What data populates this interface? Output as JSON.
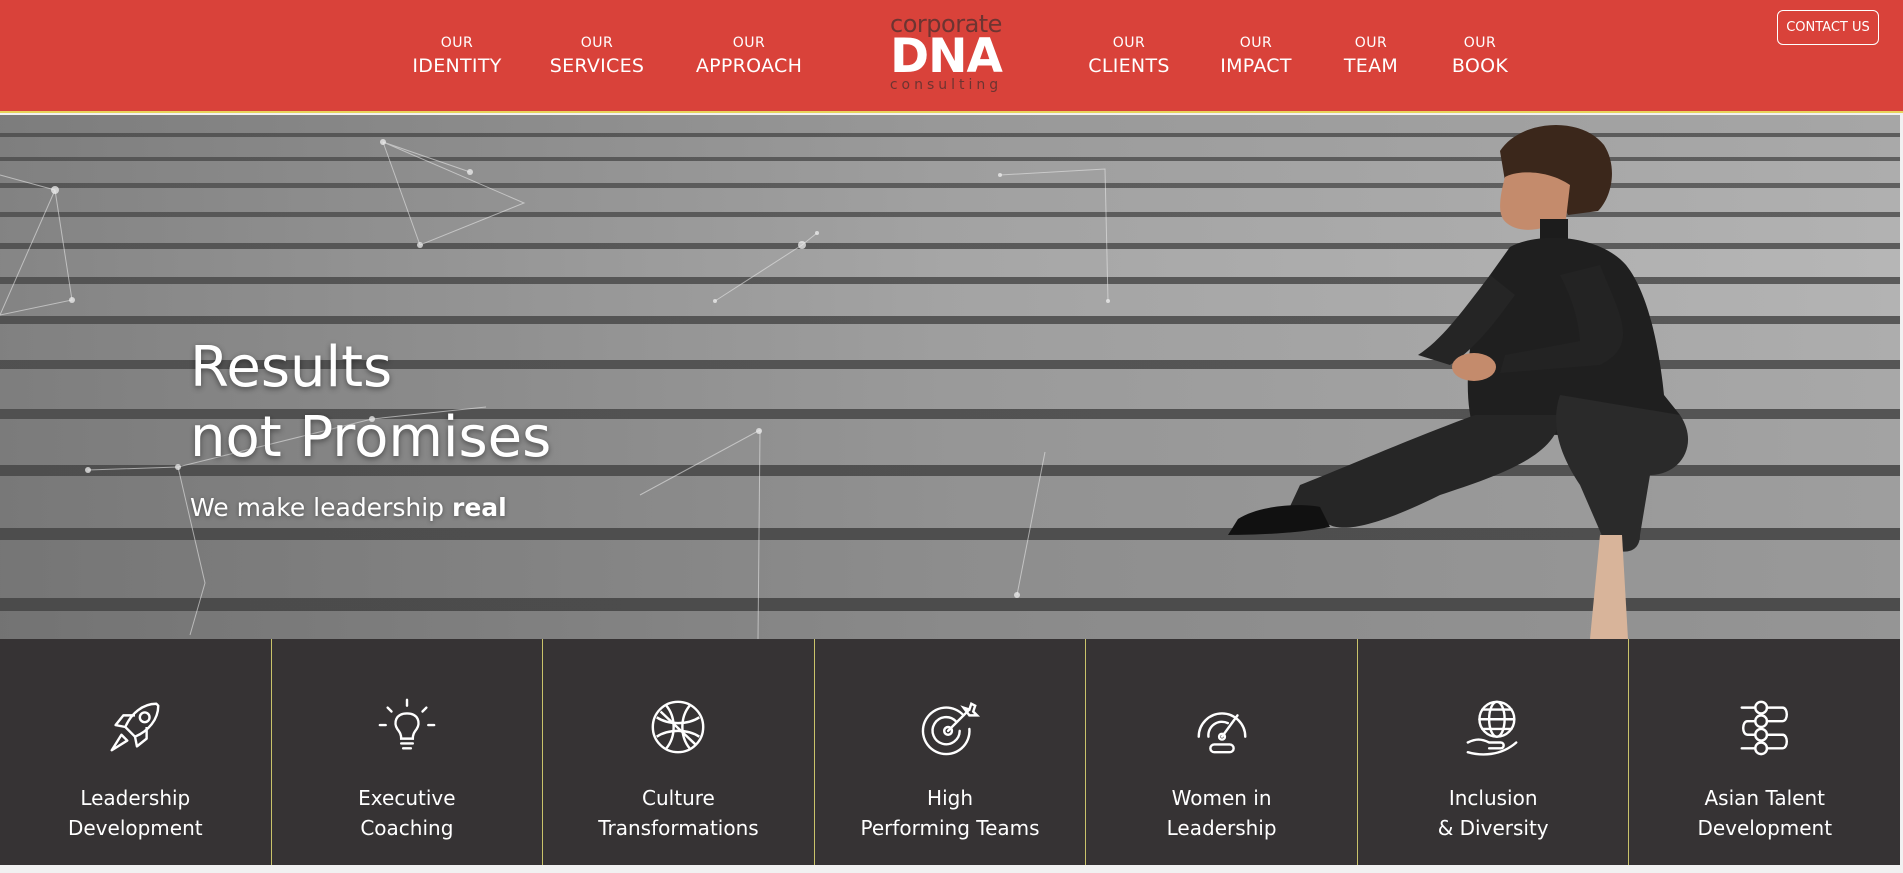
{
  "nav": {
    "left": [
      {
        "small": "OUR",
        "big": "IDENTITY"
      },
      {
        "small": "OUR",
        "big": "SERVICES"
      },
      {
        "small": "OUR",
        "big": "APPROACH"
      }
    ],
    "right": [
      {
        "small": "OUR",
        "big": "CLIENTS"
      },
      {
        "small": "OUR",
        "big": "IMPACT"
      },
      {
        "small": "OUR",
        "big": "TEAM"
      },
      {
        "small": "OUR",
        "big": "BOOK"
      }
    ]
  },
  "logo": {
    "line1": "corporate",
    "line2": "DNA",
    "line3": "consulting"
  },
  "contact_label": "CONTACT US",
  "hero": {
    "title_line1": "Results",
    "title_line2": "not Promises",
    "subtitle_prefix": "We make leadership ",
    "subtitle_bold": "real"
  },
  "services": [
    {
      "icon": "rocket-icon",
      "line1": "Leadership",
      "line2": "Development"
    },
    {
      "icon": "lightbulb-icon",
      "line1": "Executive",
      "line2": "Coaching"
    },
    {
      "icon": "globe-icon",
      "line1": "Culture",
      "line2": "Transformations"
    },
    {
      "icon": "target-icon",
      "line1": "High",
      "line2": "Performing Teams"
    },
    {
      "icon": "gauge-icon",
      "line1": "Women in",
      "line2": "Leadership"
    },
    {
      "icon": "hand-globe-icon",
      "line1": "Inclusion",
      "line2": "& Diversity"
    },
    {
      "icon": "sliders-icon",
      "line1": "Asian Talent",
      "line2": "Development"
    }
  ],
  "colors": {
    "header": "#d9423a",
    "accent": "#e8d35b",
    "strip": "#363334"
  }
}
